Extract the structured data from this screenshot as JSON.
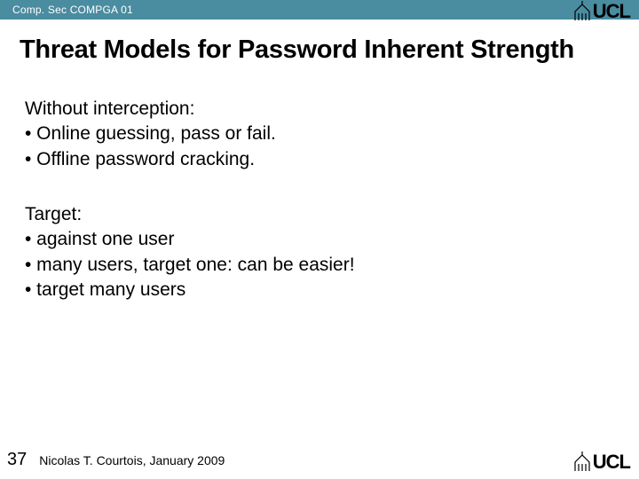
{
  "header": {
    "course": "Comp. Sec COMPGA 01"
  },
  "logo": {
    "text": "UCL"
  },
  "title": "Threat Models for Password Inherent Strength",
  "section1": {
    "heading": "Without interception:",
    "b1": "•  Online guessing, pass or fail.",
    "b2": "•  Offline password cracking."
  },
  "section2": {
    "heading": "Target:",
    "b1": "•  against one user",
    "b2": "•  many users, target one: can be easier!",
    "b3": "•  target many users"
  },
  "footer": {
    "page": "37",
    "author": "Nicolas T. Courtois, January 2009"
  }
}
